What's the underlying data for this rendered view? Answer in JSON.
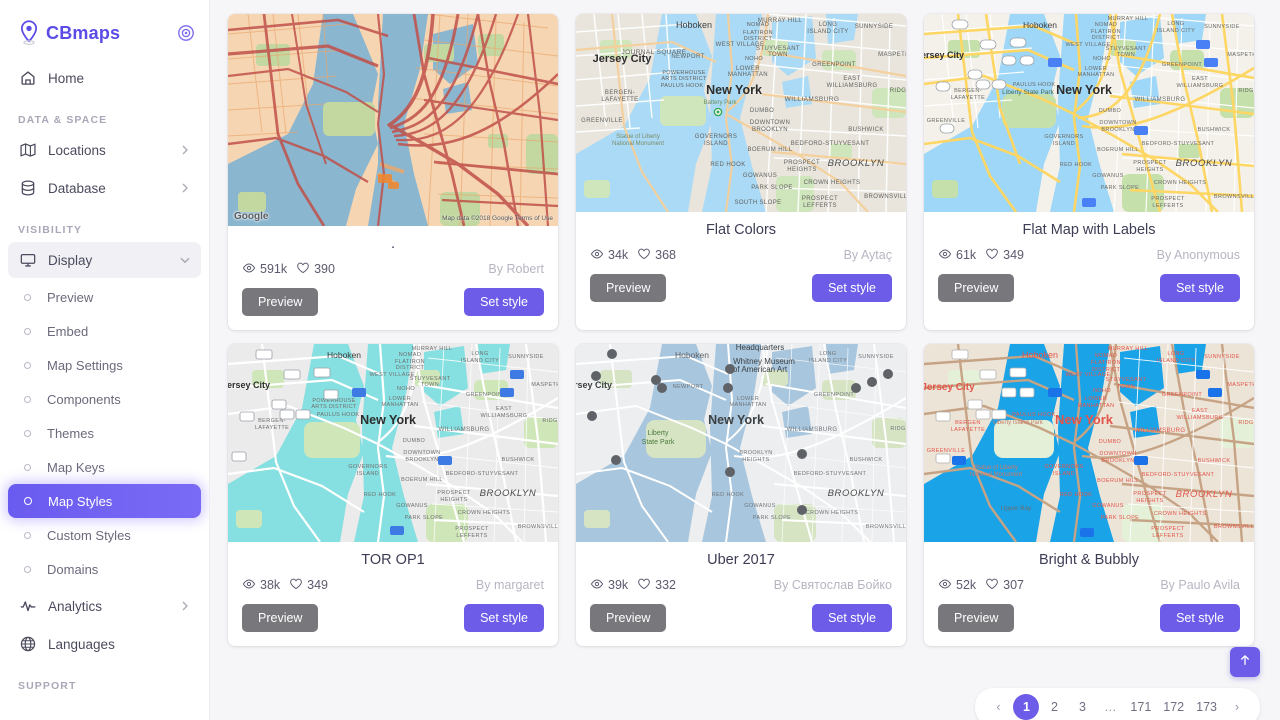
{
  "sidebar": {
    "brand": "CBmaps",
    "collapse_icon": "target-circle-icon",
    "home": {
      "label": "Home",
      "icon": "home-icon"
    },
    "sections": [
      {
        "label": "DATA & SPACE"
      },
      {
        "label": "VISIBILITY"
      },
      {
        "label": "SUPPORT"
      }
    ],
    "data_space_items": [
      {
        "label": "Locations",
        "icon": "map-fold-icon",
        "chevron": "chevron-right-icon"
      },
      {
        "label": "Database",
        "icon": "database-icon",
        "chevron": "chevron-right-icon"
      }
    ],
    "display": {
      "label": "Display",
      "icon": "monitor-icon",
      "chevron": "chevron-down-icon"
    },
    "display_children": [
      {
        "label": "Preview",
        "selected": false
      },
      {
        "label": "Embed",
        "selected": false
      },
      {
        "label": "Map Settings",
        "selected": false
      },
      {
        "label": "Components",
        "selected": false
      },
      {
        "label": "Themes",
        "selected": false
      },
      {
        "label": "Map Keys",
        "selected": false
      },
      {
        "label": "Map Styles",
        "selected": true
      },
      {
        "label": "Custom Styles",
        "selected": false
      },
      {
        "label": "Domains",
        "selected": false
      }
    ],
    "visibility_tail": [
      {
        "label": "Analytics",
        "icon": "pulse-icon",
        "chevron": "chevron-right-icon"
      },
      {
        "label": "Languages",
        "icon": "globe-icon",
        "chevron": ""
      }
    ]
  },
  "buttons": {
    "preview": "Preview",
    "set_style": "Set style"
  },
  "icons": {
    "views": "eye-icon",
    "likes": "heart-icon",
    "scroll_top": "arrow-up-icon"
  },
  "cards": [
    {
      "title": ".",
      "views": "591k",
      "likes": "390",
      "author": "By Robert",
      "map_watermark": "Google",
      "map_attribution": "Map data ©2018 Google   Terms of Use",
      "style": "orange-roads"
    },
    {
      "title": "Flat Colors",
      "views": "34k",
      "likes": "368",
      "author": "By Aytaç",
      "style": "flat-beige"
    },
    {
      "title": "Flat Map with Labels",
      "views": "61k",
      "likes": "349",
      "author": "By Anonymous",
      "style": "yellow-roads"
    },
    {
      "title": "TOR OP1",
      "views": "38k",
      "likes": "349",
      "author": "By margaret",
      "style": "turquoise-water"
    },
    {
      "title": "Uber 2017",
      "views": "39k",
      "likes": "332",
      "author": "By Святослав Бойко",
      "style": "muted-grey"
    },
    {
      "title": "Bright & Bubbly",
      "views": "52k",
      "likes": "307",
      "author": "By Paulo Avila",
      "style": "vivid-blue"
    }
  ],
  "map_labels": {
    "jersey_city": "Jersey City",
    "new_york": "New York",
    "hoboken": "Hoboken",
    "brooklyn": "BROOKLYN",
    "williamsburg": "WILLIAMSBURG",
    "greenpoint": "GREENPOINT",
    "dumbo": "DUMBO",
    "red_hook": "RED HOOK",
    "governors_island": "GOVERNORS ISLAND",
    "lower_manhattan": "LOWER MANHATTAN",
    "park_slope": "PARK SLOPE",
    "bushwick": "BUSHWICK",
    "maspeth": "MASPETH",
    "sunnyside": "SUNNYSIDE",
    "long_island_city": "LONG ISLAND CITY",
    "murray_hill": "MURRAY HILL",
    "west_village": "WEST VILLAGE",
    "nomad": "NOMAD",
    "stuyvesant_town": "STUYVESANT TOWN",
    "crown_heights": "CROWN HEIGHTS",
    "bedford_stuyvesant": "BEDFORD-STUYVESANT",
    "prospect_heights": "PROSPECT HEIGHTS",
    "boerum_hill": "BOERUM HILL",
    "gowanus": "GOWANUS",
    "greenville": "GREENVILLE",
    "liberty_state_park": "Liberty State Park",
    "statue_of_liberty": "Statue of Liberty National Monument",
    "paulus_hook": "PAULUS HOOK",
    "downtown_brooklyn": "DOWNTOWN BROOKLYN",
    "brownsville": "BROWNSVILLE",
    "prospect_lefferts": "PROSPECT LEFFERTS",
    "whitney_museum": "Whitney Museum of American Art",
    "headquarters": "Headquarters",
    "upper_bay": "Upper Bay",
    "journal_square": "JOURNAL SQUARE",
    "bergen_lafayette": "BERGEN-LAFAYETTE",
    "east_williamsburg": "EAST WILLIAMSBURG",
    "south_slope": "SOUTH SLOPE",
    "flatiron_district": "FLATIRON DISTRICT",
    "newport": "NEWPORT",
    "noho": "NOHO",
    "battery_park": "Battery Park",
    "brooklyn_heights": "BROOKLYN HEIGHTS",
    "ridg": "RIDG"
  },
  "pagination": {
    "prev": "‹",
    "next": "›",
    "ellipsis": "…",
    "pages": [
      "1",
      "2",
      "3",
      "171",
      "172",
      "173"
    ],
    "current": "1"
  }
}
